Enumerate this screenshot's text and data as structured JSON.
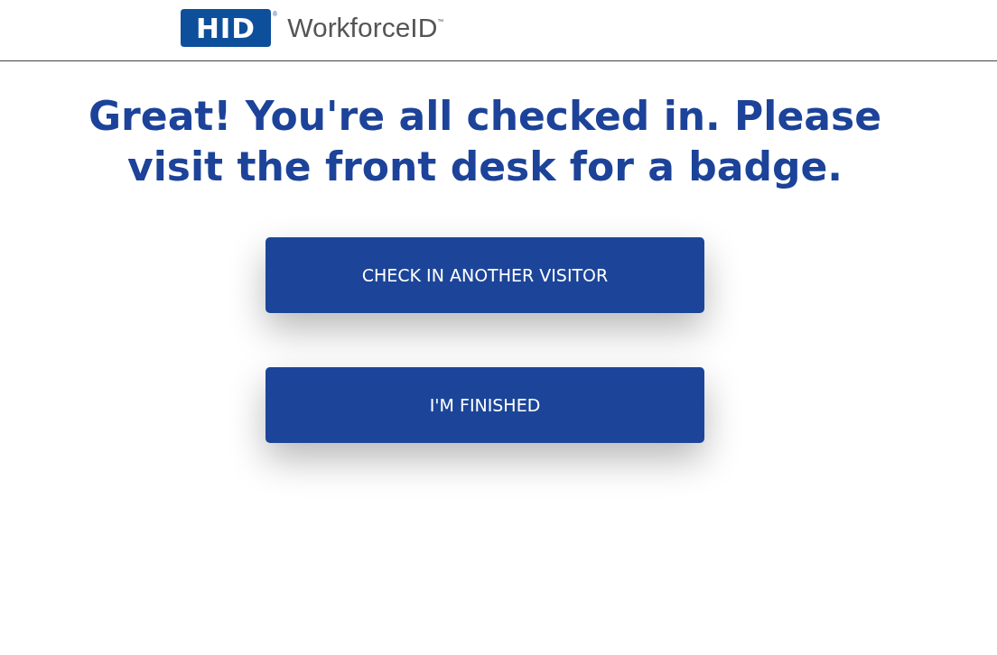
{
  "header": {
    "logo": {
      "mark": "HID",
      "registered": "®",
      "product": "WorkforceID",
      "trademark": "™"
    }
  },
  "message": "Great! You're all checked in. Please visit the front desk for a badge.",
  "buttons": [
    {
      "label": "CHECK IN ANOTHER VISITOR"
    },
    {
      "label": "I'M FINISHED"
    }
  ]
}
